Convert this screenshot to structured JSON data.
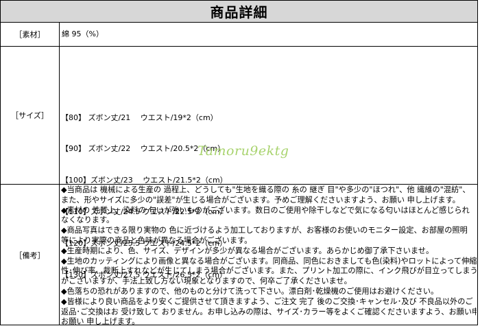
{
  "title": "商品詳細",
  "material": {
    "label": "［素材］",
    "value": "綿 95（%）"
  },
  "size": {
    "label": "［サイズ］",
    "lines": [
      "【80】 ズボン丈/21　 ウエスト/19*2（cm）",
      "【90】 ズボン丈/22　 ウエスト/20.5*2（cm）",
      "【100】ズボン丈/23　 ウエスト/21.5*2（cm）",
      "【110】ズボン丈/24.5 ウエスト/22.5*2（cm）",
      "【120】ズボン丈/25.5 ウエスト/24.5*2（cm）",
      "【130】ズボン丈/27.5 ウエスト/26.5*2（cm）"
    ],
    "watermark": "Tamoru9ektg"
  },
  "notes": {
    "label": "［備考］",
    "lines": [
      "◆当商品は 機械による生産の 過程上、どうしても\"生地を織る際の 糸の 継ぎ 目\"や多少の\"ほつれ\"、他 繊維の\"混紡\"、",
      "また、形やサイズに多少の\"誤差\"が生じる場合がございます。予めご理解くださいますよう、お願い 申し上げます。",
      "◆素材の 性質上、染料の 匂いが強いものがございます。数日のご使用や除干しなどで気になる匂いはほとんど感じられ",
      "なくなります。",
      "◆商品写真はできる限り実物の 色に近づけるよう加工しておりますが、お客様のお使いのモニター設定、お部屋の照明",
      "等により実際の商品と色味が異なる場合がございます。",
      "◆生産時期により、色、サイズ、デザインが多少が異なる場合がございます。あらかじめ御了承下さいませ。",
      "◆生地のカッティングにより画像と異なる場合がございます。同商品、同色におきましても色(染料)やロットによって伸縮",
      "性･伸び率、裁断上すれなどが生じてしまう場合がございます。また、プリント加工の際に、インク飛びが目立ってしまう場合",
      "がございますが、手法上致し方ない現象となりますので、何卒ご了承くださいませ。",
      "◆色落ちの恐れがありますので、他のものと分けて洗って下さい。漂白剤･乾燥機のご使用はお避けください。",
      "◆皆様により良い商品をより安くご提供させて頂きますよう、ご注文 完了 後のご交換･キャンセル･及び 不良品以外のご",
      "返品･ご交換はお 受け致して おりません。お申し込みの際は、サイズ･カラー等をよくご確認くださいますよう、お願い申し上げます",
      "お願い 申し上げます。"
    ]
  }
}
